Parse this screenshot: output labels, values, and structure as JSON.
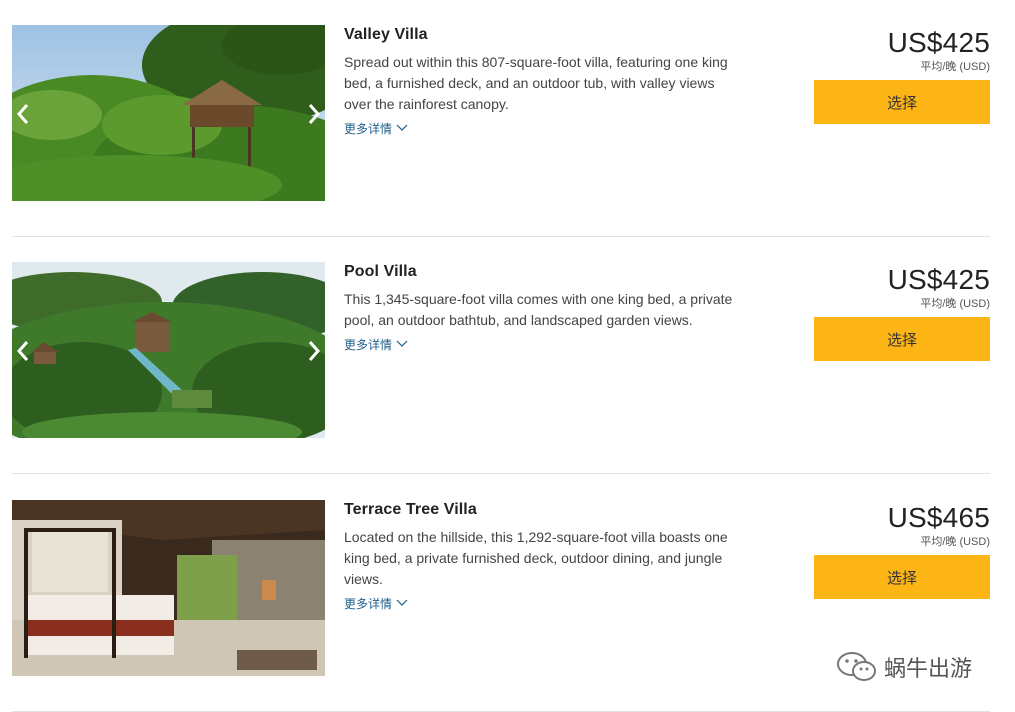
{
  "rooms": [
    {
      "title": "Valley Villa",
      "description": "Spread out within this 807-square-foot villa, featuring one king bed, a furnished deck, and an outdoor tub, with valley views over the rainforest canopy.",
      "more_label": "更多详情",
      "price": "US$425",
      "price_note": "平均/晚 (USD)",
      "select_label": "选择",
      "photo": "jungle-treehouse-villa"
    },
    {
      "title": "Pool Villa",
      "description": "This 1,345-square-foot villa comes with one king bed, a private pool, an outdoor bathtub, and landscaped garden views.",
      "more_label": "更多详情",
      "price": "US$425",
      "price_note": "平均/晚 (USD)",
      "select_label": "选择",
      "photo": "aerial-pool-villa"
    },
    {
      "title": "Terrace Tree Villa",
      "description": "Located on the hillside, this 1,292-square-foot villa boasts one king bed, a private furnished deck, outdoor dining, and jungle views.",
      "more_label": "更多详情",
      "price": "US$465",
      "price_note": "平均/晚 (USD)",
      "select_label": "选择",
      "photo": "canopy-bed-interior"
    }
  ],
  "watermark": {
    "text": "蜗牛出游",
    "icon": "wechat-logo-icon"
  },
  "colors": {
    "select_button": "#fdb515",
    "more_link": "#1f5f8b",
    "divider": "#e2e2e2"
  }
}
